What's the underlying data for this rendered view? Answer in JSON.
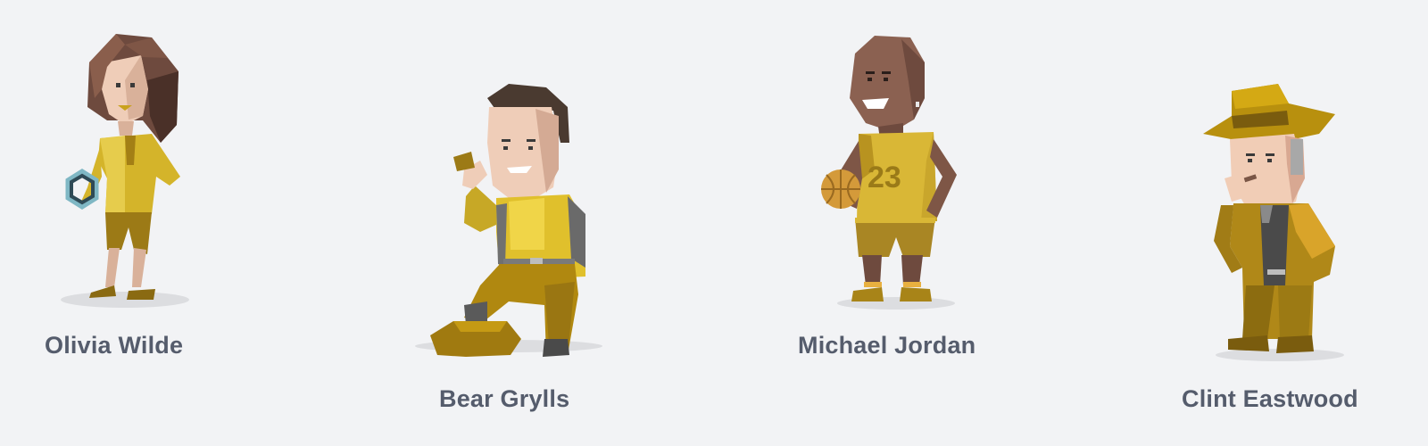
{
  "characters": [
    {
      "name": "Olivia Wilde",
      "icon": "olivia-wilde-avatar-icon"
    },
    {
      "name": "Bear Grylls",
      "icon": "bear-grylls-avatar-icon"
    },
    {
      "name": "Michael Jordan",
      "icon": "michael-jordan-avatar-icon"
    },
    {
      "name": "Clint Eastwood",
      "icon": "clint-eastwood-avatar-icon"
    }
  ],
  "jersey_number": "23",
  "colors": {
    "background": "#f2f3f5",
    "label": "#555c6c",
    "mustard": "#d4b42a",
    "gold_dark": "#9c7a16",
    "brown_hair": "#6e4a3e",
    "skin_light": "#efcdb8",
    "skin_dark": "#7e5646",
    "shadow": "#d9dadd"
  }
}
